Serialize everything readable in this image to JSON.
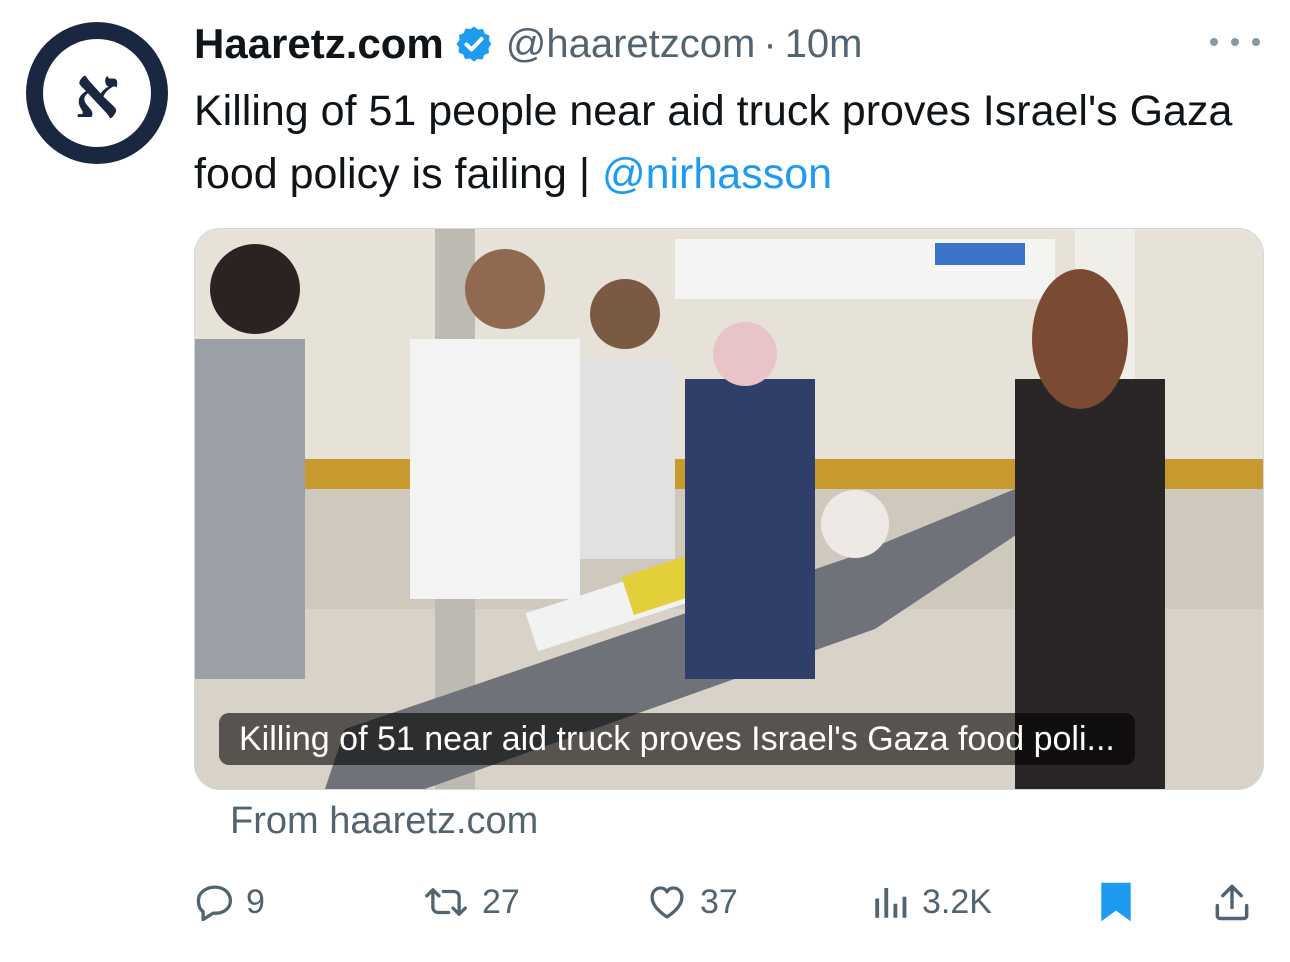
{
  "tweet": {
    "display_name": "Haaretz.com",
    "handle": "@haaretzcom",
    "separator": "·",
    "time": "10m",
    "avatar_letter": "א",
    "text": "Killing of 51 people near aid truck proves Israel's Gaza food policy is failing | ",
    "mention": "@nirhasson"
  },
  "card": {
    "title": "Killing of 51 near aid truck proves Israel's Gaza food poli...",
    "source": "From haaretz.com"
  },
  "actions": {
    "replies": "9",
    "reposts": "27",
    "likes": "37",
    "views": "3.2K"
  },
  "icons": {
    "verified": "verified-badge-icon",
    "more": "more-options-icon",
    "reply": "reply-icon",
    "repost": "repost-icon",
    "like": "heart-icon",
    "views": "views-chart-icon",
    "bookmark": "bookmark-icon",
    "share": "share-icon"
  },
  "colors": {
    "accent": "#1d9bf0",
    "secondary_text": "#536471",
    "avatar_navy": "#1a2740"
  }
}
